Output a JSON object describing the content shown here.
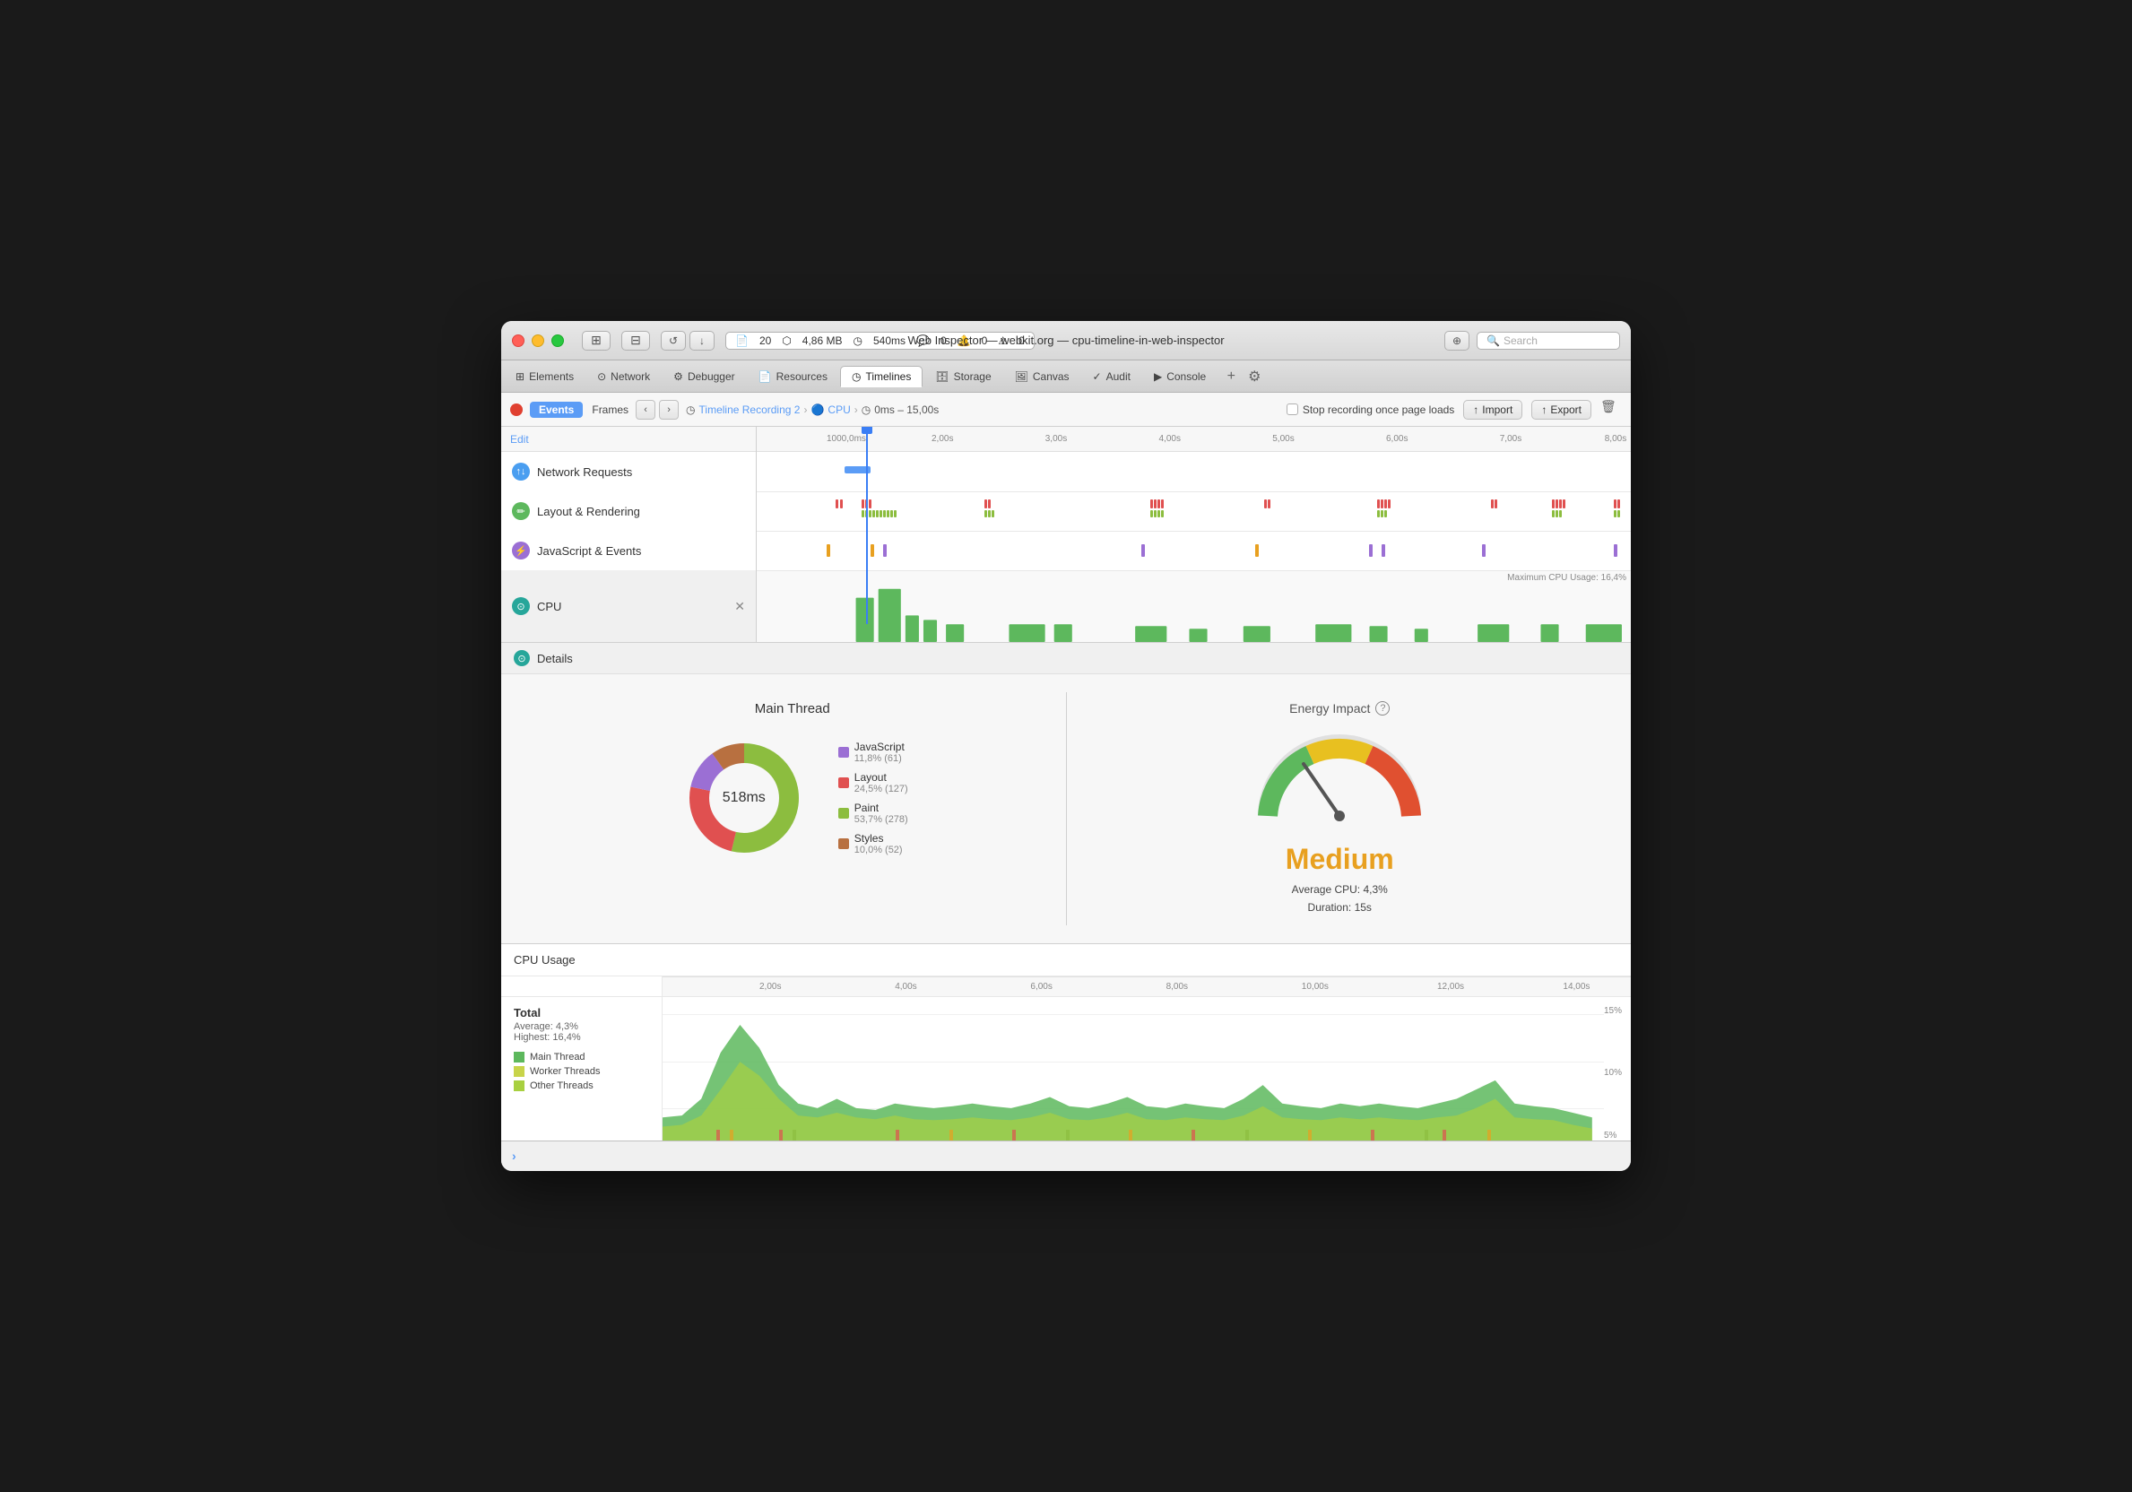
{
  "window": {
    "title": "Web Inspector — webkit.org — cpu-timeline-in-web-inspector"
  },
  "titlebar": {
    "reload_label": "↺",
    "download_label": "↓",
    "pages_count": "20",
    "memory": "4,86 MB",
    "time": "540ms",
    "errors": "0",
    "warnings": "0",
    "alerts": "0",
    "crosshair_label": "⊕",
    "search_placeholder": "Search"
  },
  "tabs": [
    {
      "id": "elements",
      "label": "Elements",
      "icon": "grid"
    },
    {
      "id": "network",
      "label": "Network",
      "icon": "network"
    },
    {
      "id": "debugger",
      "label": "Debugger",
      "icon": "bug"
    },
    {
      "id": "resources",
      "label": "Resources",
      "icon": "file"
    },
    {
      "id": "timelines",
      "label": "Timelines",
      "icon": "clock",
      "active": true
    },
    {
      "id": "storage",
      "label": "Storage",
      "icon": "database"
    },
    {
      "id": "canvas",
      "label": "Canvas",
      "icon": "image"
    },
    {
      "id": "audit",
      "label": "Audit",
      "icon": "check"
    },
    {
      "id": "console",
      "label": "Console",
      "icon": "terminal"
    }
  ],
  "recbar": {
    "events_label": "Events",
    "frames_label": "Frames",
    "recording_label": "Timeline Recording 2",
    "cpu_label": "CPU",
    "time_range": "0ms – 15,00s",
    "stop_label": "Stop recording once page loads",
    "import_label": "Import",
    "export_label": "Export"
  },
  "timeline_rows": [
    {
      "id": "network",
      "label": "Network Requests",
      "color": "blue"
    },
    {
      "id": "layout",
      "label": "Layout & Rendering",
      "color": "green"
    },
    {
      "id": "js",
      "label": "JavaScript & Events",
      "color": "purple"
    },
    {
      "id": "cpu",
      "label": "CPU",
      "color": "teal"
    }
  ],
  "time_labels": [
    "1000,0ms",
    "2,00s",
    "3,00s",
    "4,00s",
    "5,00s",
    "6,00s",
    "7,00s",
    "8,00s"
  ],
  "cpu_max_label": "Maximum CPU Usage: 16,4%",
  "details": {
    "title": "Details",
    "main_thread": {
      "title": "Main Thread",
      "center_label": "518ms",
      "legend": [
        {
          "color": "#9b6fd4",
          "label": "JavaScript",
          "sub": "11,8% (61)"
        },
        {
          "color": "#e05050",
          "label": "Layout",
          "sub": "24,5% (127)"
        },
        {
          "color": "#8cbd3f",
          "label": "Paint",
          "sub": "53,7% (278)"
        },
        {
          "color": "#b87040",
          "label": "Styles",
          "sub": "10,0% (52)"
        }
      ]
    },
    "energy": {
      "title": "Energy Impact",
      "level": "Medium",
      "avg_cpu": "Average CPU: 4,3%",
      "duration": "Duration: 15s"
    }
  },
  "cpu_usage": {
    "title": "CPU Usage",
    "total_label": "Total",
    "avg": "Average: 4,3%",
    "highest": "Highest: 16,4%",
    "legend": [
      {
        "color": "#5db85d",
        "label": "Main Thread"
      },
      {
        "color": "#c8d44a",
        "label": "Worker Threads"
      },
      {
        "color": "#a8d040",
        "label": "Other Threads"
      }
    ],
    "y_labels": [
      "15%",
      "10%",
      "5%"
    ],
    "time_labels": [
      "2,00s",
      "4,00s",
      "6,00s",
      "8,00s",
      "10,00s",
      "12,00s",
      "14,00s"
    ]
  },
  "bottombar": {
    "prompt": "›"
  }
}
